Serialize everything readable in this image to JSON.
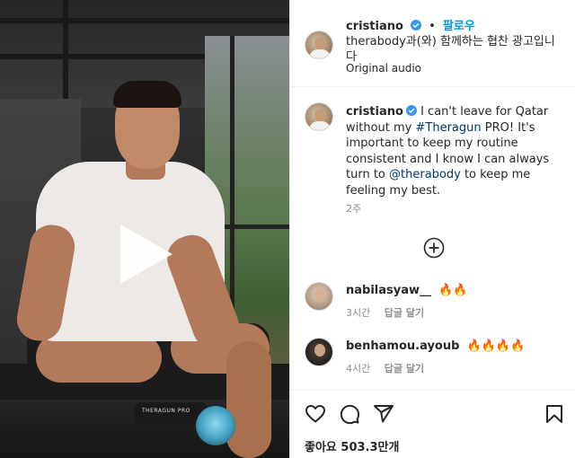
{
  "post": {
    "author": "cristiano",
    "follow_label": "팔로우",
    "partner_line": "therabody과(와) 함께하는 협찬 광고입니다",
    "audio": "Original audio"
  },
  "caption": {
    "author": "cristiano",
    "text_part1": "I can't leave for Qatar without my ",
    "hashtag": "#Theragun",
    "text_part2": " PRO! It's important to keep my routine consistent and I know I can always turn to ",
    "mention": "@therabody",
    "text_part3": " to keep me feeling my best.",
    "time": "2주"
  },
  "comments": [
    {
      "user": "nabilasyaw__",
      "text": "🔥🔥",
      "time": "3시간",
      "reply_label": "답글 달기"
    },
    {
      "user": "benhamou.ayoub",
      "text": "🔥🔥🔥🔥",
      "time": "4시간",
      "reply_label": "답글 달기"
    }
  ],
  "likes_text": "좋아요 503.3만개",
  "video": {
    "device_brand": "THERAGUN PRO"
  },
  "colors": {
    "accent": "#0095f6",
    "verified": "#3897f0",
    "link": "#00376b",
    "muted": "#8e8e8e"
  },
  "icons": [
    "verified-badge-icon",
    "play-icon",
    "add-more-comments-icon",
    "heart-icon",
    "comment-icon",
    "share-icon",
    "bookmark-icon"
  ]
}
